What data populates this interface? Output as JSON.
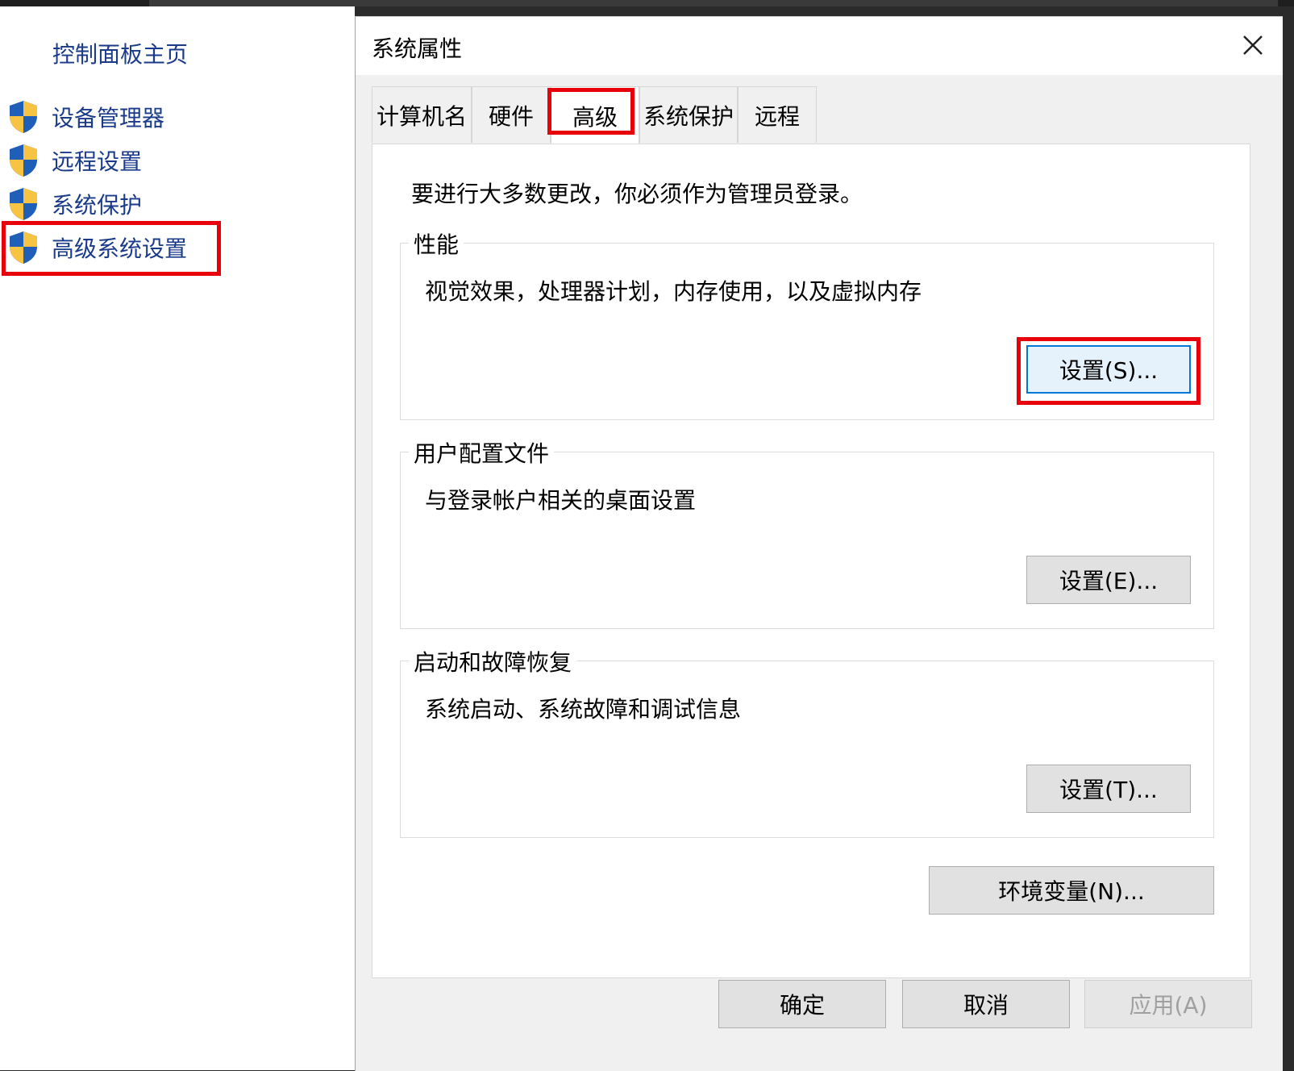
{
  "sidebar": {
    "home": "控制面板主页",
    "items": [
      {
        "label": "设备管理器"
      },
      {
        "label": "远程设置"
      },
      {
        "label": "系统保护"
      },
      {
        "label": "高级系统设置"
      }
    ]
  },
  "dialog": {
    "title": "系统属性",
    "tabs": [
      "计算机名",
      "硬件",
      "高级",
      "系统保护",
      "远程"
    ],
    "active_tab": "高级",
    "notice": "要进行大多数更改，你必须作为管理员登录。",
    "groups": {
      "performance": {
        "legend": "性能",
        "desc": "视觉效果，处理器计划，内存使用，以及虚拟内存",
        "button": "设置(S)..."
      },
      "profile": {
        "legend": "用户配置文件",
        "desc": "与登录帐户相关的桌面设置",
        "button": "设置(E)..."
      },
      "startup": {
        "legend": "启动和故障恢复",
        "desc": "系统启动、系统故障和调试信息",
        "button": "设置(T)..."
      }
    },
    "env_button": "环境变量(N)...",
    "footer": {
      "ok": "确定",
      "cancel": "取消",
      "apply": "应用(A)"
    }
  },
  "colors": {
    "highlight": "#e8000b",
    "link": "#1a3a8a",
    "focus": "#0078d7"
  }
}
